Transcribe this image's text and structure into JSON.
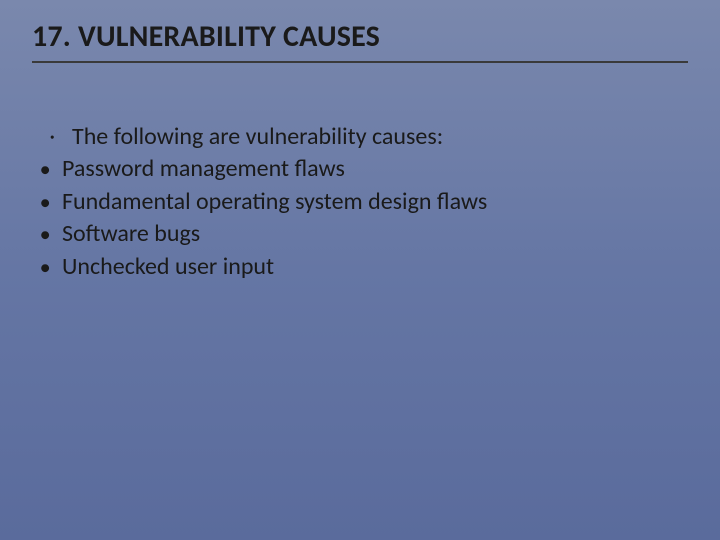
{
  "slide": {
    "title": "17. VULNERABILITY CAUSES",
    "intro": {
      "bullet": "•",
      "text": "The following are vulnerability causes:"
    },
    "items": [
      {
        "bullet": "●",
        "text": "Password management flaws"
      },
      {
        "bullet": "●",
        "text": "Fundamental operating system design flaws"
      },
      {
        "bullet": "●",
        "text": "Software bugs"
      },
      {
        "bullet": "●",
        "text": "Unchecked user input"
      }
    ]
  }
}
